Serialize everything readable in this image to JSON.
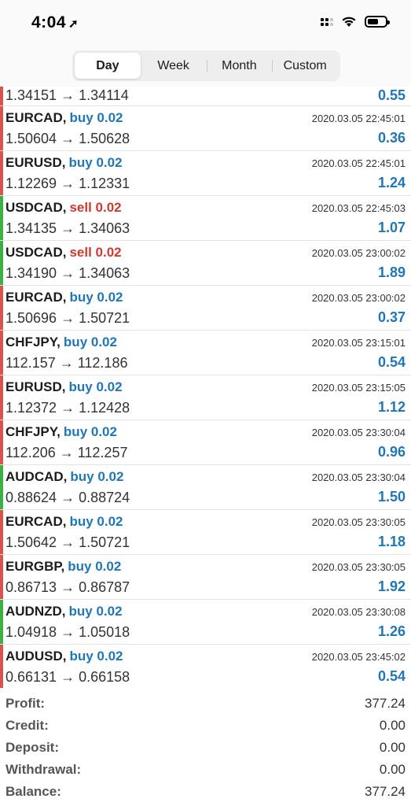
{
  "status_bar": {
    "time": "4:04",
    "location_glyph": "➚"
  },
  "segments": [
    {
      "label": "Day",
      "active": true
    },
    {
      "label": "Week",
      "active": false
    },
    {
      "label": "Month",
      "active": false
    },
    {
      "label": "Custom",
      "active": false
    }
  ],
  "colors": {
    "buy": "#1f77b8",
    "sell": "#cc3b2e",
    "profit": "#1f77b8",
    "bar_red": "#d9534f",
    "bar_green": "#3cb043"
  },
  "first_row": {
    "prices": "1.34151 → 1.34114",
    "profit": "0.55",
    "bar": "red"
  },
  "trades": [
    {
      "symbol": "EURCAD,",
      "side": "buy 0.02",
      "dir": "buy",
      "time": "2020.03.05 22:45:01",
      "prices": "1.50604 → 1.50628",
      "profit": "0.36",
      "bar": "red"
    },
    {
      "symbol": "EURUSD,",
      "side": "buy 0.02",
      "dir": "buy",
      "time": "2020.03.05 22:45:01",
      "prices": "1.12269 → 1.12331",
      "profit": "1.24",
      "bar": "red"
    },
    {
      "symbol": "USDCAD,",
      "side": "sell 0.02",
      "dir": "sell",
      "time": "2020.03.05 22:45:03",
      "prices": "1.34135 → 1.34063",
      "profit": "1.07",
      "bar": "green"
    },
    {
      "symbol": "USDCAD,",
      "side": "sell 0.02",
      "dir": "sell",
      "time": "2020.03.05 23:00:02",
      "prices": "1.34190 → 1.34063",
      "profit": "1.89",
      "bar": "green"
    },
    {
      "symbol": "EURCAD,",
      "side": "buy 0.02",
      "dir": "buy",
      "time": "2020.03.05 23:00:02",
      "prices": "1.50696 → 1.50721",
      "profit": "0.37",
      "bar": "red"
    },
    {
      "symbol": "CHFJPY,",
      "side": "buy 0.02",
      "dir": "buy",
      "time": "2020.03.05 23:15:01",
      "prices": "112.157 → 112.186",
      "profit": "0.54",
      "bar": "red"
    },
    {
      "symbol": "EURUSD,",
      "side": "buy 0.02",
      "dir": "buy",
      "time": "2020.03.05 23:15:05",
      "prices": "1.12372 → 1.12428",
      "profit": "1.12",
      "bar": "red"
    },
    {
      "symbol": "CHFJPY,",
      "side": "buy 0.02",
      "dir": "buy",
      "time": "2020.03.05 23:30:04",
      "prices": "112.206 → 112.257",
      "profit": "0.96",
      "bar": "red"
    },
    {
      "symbol": "AUDCAD,",
      "side": "buy 0.02",
      "dir": "buy",
      "time": "2020.03.05 23:30:04",
      "prices": "0.88624 → 0.88724",
      "profit": "1.50",
      "bar": "green"
    },
    {
      "symbol": "EURCAD,",
      "side": "buy 0.02",
      "dir": "buy",
      "time": "2020.03.05 23:30:05",
      "prices": "1.50642 → 1.50721",
      "profit": "1.18",
      "bar": "red"
    },
    {
      "symbol": "EURGBP,",
      "side": "buy 0.02",
      "dir": "buy",
      "time": "2020.03.05 23:30:05",
      "prices": "0.86713 → 0.86787",
      "profit": "1.92",
      "bar": "red"
    },
    {
      "symbol": "AUDNZD,",
      "side": "buy 0.02",
      "dir": "buy",
      "time": "2020.03.05 23:30:08",
      "prices": "1.04918 → 1.05018",
      "profit": "1.26",
      "bar": "green"
    },
    {
      "symbol": "AUDUSD,",
      "side": "buy 0.02",
      "dir": "buy",
      "time": "2020.03.05 23:45:02",
      "prices": "0.66131 → 0.66158",
      "profit": "0.54",
      "bar": "red"
    }
  ],
  "summary": [
    {
      "label": "Profit:",
      "value": "377.24"
    },
    {
      "label": "Credit:",
      "value": "0.00"
    },
    {
      "label": "Deposit:",
      "value": "0.00"
    },
    {
      "label": "Withdrawal:",
      "value": "0.00"
    },
    {
      "label": "Balance:",
      "value": "377.24"
    }
  ]
}
